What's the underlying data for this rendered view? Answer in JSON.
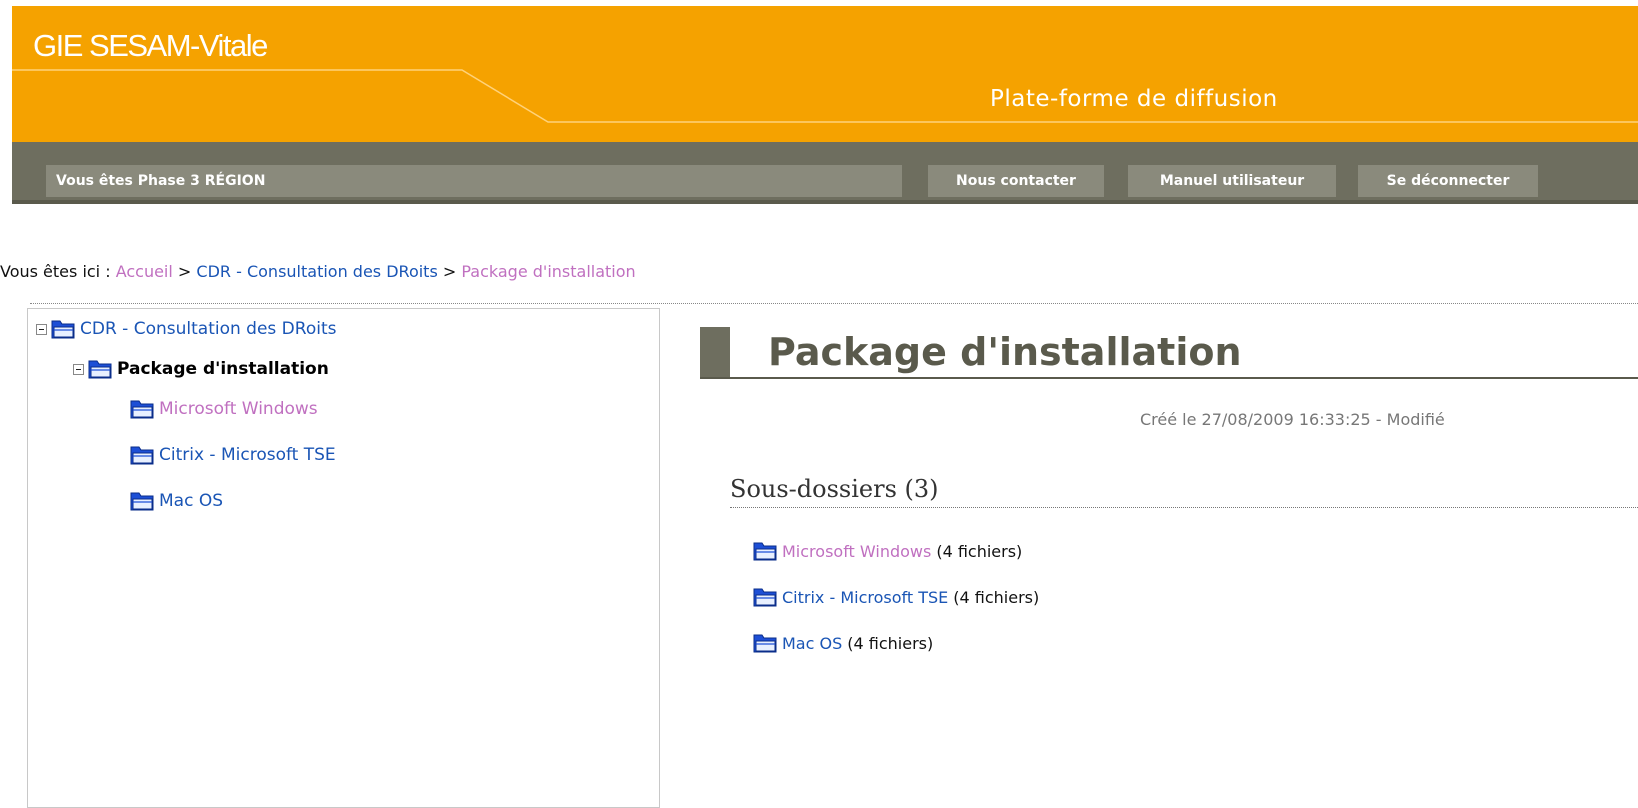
{
  "header": {
    "brand": "GIE SESAM-Vitale",
    "platform_title": "Plate-forme de diffusion",
    "colors": {
      "header_bg": "#f5a200",
      "nav_bg": "#6e6e5f",
      "accent": "#5a5a4c"
    }
  },
  "navbar": {
    "user_label": "Vous êtes Phase 3 RÉGION",
    "buttons": [
      "Nous contacter",
      "Manuel utilisateur",
      "Se déconnecter"
    ]
  },
  "breadcrumb": {
    "prefix": "Vous êtes ici : ",
    "items": [
      "Accueil",
      "CDR - Consultation des DRoits",
      "Package d'installation"
    ],
    "separator": " > "
  },
  "tree": {
    "root": "CDR - Consultation des DRoits",
    "current": "Package d'installation",
    "children": [
      "Microsoft Windows",
      "Citrix - Microsoft TSE",
      "Mac OS"
    ],
    "icon": "folder-icon"
  },
  "content": {
    "title": "Package d'installation",
    "meta": "Créé le 27/08/2009 16:33:25 - Modifié",
    "section_title": "Sous-dossiers (3)",
    "subfolders": [
      {
        "name": "Microsoft Windows",
        "count": "(4 fichiers)"
      },
      {
        "name": "Citrix - Microsoft TSE",
        "count": "(4 fichiers)"
      },
      {
        "name": "Mac OS",
        "count": "(4 fichiers)"
      }
    ]
  }
}
